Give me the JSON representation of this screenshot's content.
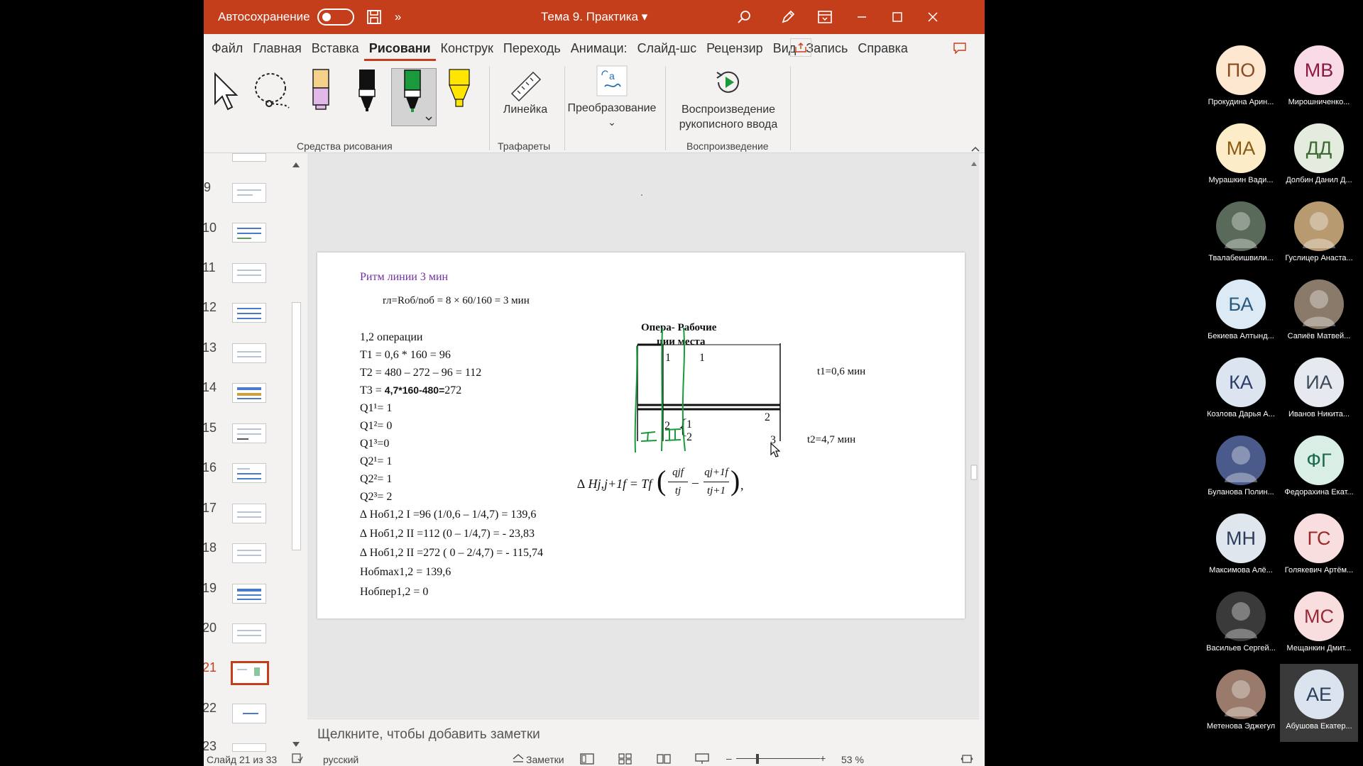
{
  "titlebar": {
    "autosave_label": "Автосохранение",
    "more_label": "»",
    "doc_title": "Тема 9. Практика",
    "doc_chevron": "▾"
  },
  "tabs": [
    "Файл",
    "Главная",
    "Вставка",
    "Рисовани",
    "Конструк",
    "Переходь",
    "Анимаци:",
    "Слайд-шс",
    "Рецензир",
    "Вид",
    "Запись",
    "Справка"
  ],
  "active_tab": "Рисовани",
  "ribbon": {
    "ruler_label": "Линейка",
    "convert_label": "Преобразование",
    "convert_chevron": "⌄",
    "replay_label_1": "Воспроизведение",
    "replay_label_2": "рукописного ввода",
    "group_drawing_tools": "Средства рисования",
    "group_stencils": "Трафареты",
    "group_replay": "Воспроизведение",
    "accent": "#c43e1c"
  },
  "thumbnails": {
    "numbers": [
      "9",
      "10",
      "11",
      "12",
      "13",
      "14",
      "15",
      "16",
      "17",
      "18",
      "19",
      "20",
      "21",
      "22",
      "23"
    ],
    "selected": "21"
  },
  "slide": {
    "heading": "Ритм линии  3 мин",
    "heading_color": "#7030a0",
    "formula_r": "rл=Rоб/nоб = 8 × 60/160 = 3 мин",
    "ops": "1,2 операции",
    "t1": "T1 = 0,6  * 160 = 96",
    "t2": "T2 = 480 – 272 – 96 = 112",
    "t3_pre": "T3 = ",
    "t3_bold": "4,7*160-480=",
    "t3_post": "272",
    "q11": "Q1¹= 1",
    "q12": "Q1²= 0",
    "q13": "Q1³=0",
    "q21": "Q2¹= 1",
    "q22": "Q2²= 1",
    "q23": "Q2³= 2",
    "dh1": "∆ Hоб1,2 I =96 (1/0,6 – 1/4,7) = 139,6",
    "dh2": "∆ Hоб1,2 II =112 (0 – 1/4,7) = - 23,83",
    "dh3": "∆ Hоб1,2 II =272 ( 0 – 2/4,7) = - 115,74",
    "hmax": "Hобmax1,2 = 139,6",
    "hper": "Hобпер1,2 = 0",
    "diag_col1": "Опера- Рабочие",
    "diag_col2": "ции  места",
    "op1": "1",
    "wp1": "1",
    "t1_label": "t1=0,6 мин",
    "mid2": "2",
    "op2": "2",
    "brace": "{",
    "wp_a": "1",
    "wp_b": "2",
    "mid3": "3",
    "t2_label": "t2=4,7 мин",
    "roman1": "I",
    "roman2": "II",
    "formula_dh": "∆ Hj,j+1f  = Tf",
    "frac1_num": "qjf",
    "frac1_den": "tj",
    "minus": "–",
    "frac2_num": "qj+1f",
    "frac2_den": "tj+1",
    "comma": ",",
    "ink_color": "#1a9a3a"
  },
  "notes_placeholder": "Щелкните, чтобы добавить заметки",
  "status": {
    "slide_info": "Слайд 21 из 33",
    "language": "русский",
    "notes_label": "Заметки",
    "zoom": "53 %",
    "zoom_minus": "–",
    "zoom_plus": "+"
  },
  "participants": [
    {
      "initials": "ПО",
      "name": "Прокудина Арин...",
      "bg": "#fde7d0",
      "fg": "#8a4a20",
      "photo": false
    },
    {
      "initials": "МВ",
      "name": "Мирошниченко...",
      "bg": "#f8dbe6",
      "fg": "#8a1a45",
      "photo": false
    },
    {
      "initials": "МА",
      "name": "Мурашкин Вади...",
      "bg": "#fdecc8",
      "fg": "#8a5a10",
      "photo": false
    },
    {
      "initials": "ДД",
      "name": "Долбин Данил Д...",
      "bg": "#e3ecdf",
      "fg": "#3a6a2f",
      "photo": false
    },
    {
      "initials": "",
      "name": "Твалабеишвили...",
      "bg": "#5a6a5a",
      "fg": "#fff",
      "photo": true
    },
    {
      "initials": "",
      "name": "Гуслицер Анаста...",
      "bg": "#b89a70",
      "fg": "#fff",
      "photo": true
    },
    {
      "initials": "БА",
      "name": "Бекиева Алтынд...",
      "bg": "#dbeaf5",
      "fg": "#2a5a80",
      "photo": false
    },
    {
      "initials": "",
      "name": "Сапиёв Матвей...",
      "bg": "#8a7a6a",
      "fg": "#fff",
      "photo": true
    },
    {
      "initials": "КА",
      "name": "Козлова Дарья А...",
      "bg": "#dce4f0",
      "fg": "#2a3e6a",
      "photo": false
    },
    {
      "initials": "ИА",
      "name": "Иванов Никита...",
      "bg": "#e6eaf0",
      "fg": "#3a4a5a",
      "photo": false
    },
    {
      "initials": "",
      "name": "Буланова Полин...",
      "bg": "#4a5a8a",
      "fg": "#fff",
      "photo": true
    },
    {
      "initials": "ФГ",
      "name": "Федорахина Екат...",
      "bg": "#d9efe6",
      "fg": "#1a6a4a",
      "photo": false
    },
    {
      "initials": "МН",
      "name": "Максимова Алё...",
      "bg": "#e0e6ee",
      "fg": "#2a3e5a",
      "photo": false
    },
    {
      "initials": "ГС",
      "name": "Голякевич Артём...",
      "bg": "#f8dede",
      "fg": "#9a2a2a",
      "photo": false
    },
    {
      "initials": "",
      "name": "Васильев Сергей...",
      "bg": "#3a3a3a",
      "fg": "#fff",
      "photo": true
    },
    {
      "initials": "МС",
      "name": "Мещанкин Дмит...",
      "bg": "#f8dede",
      "fg": "#9a2a3a",
      "photo": false
    },
    {
      "initials": "",
      "name": "Метенова Эджегул",
      "bg": "#9a7a6a",
      "fg": "#fff",
      "photo": true
    },
    {
      "initials": "АЕ",
      "name": "Абушова Екатер...",
      "bg": "#dbe4ee",
      "fg": "#2a3e5a",
      "photo": false
    }
  ]
}
